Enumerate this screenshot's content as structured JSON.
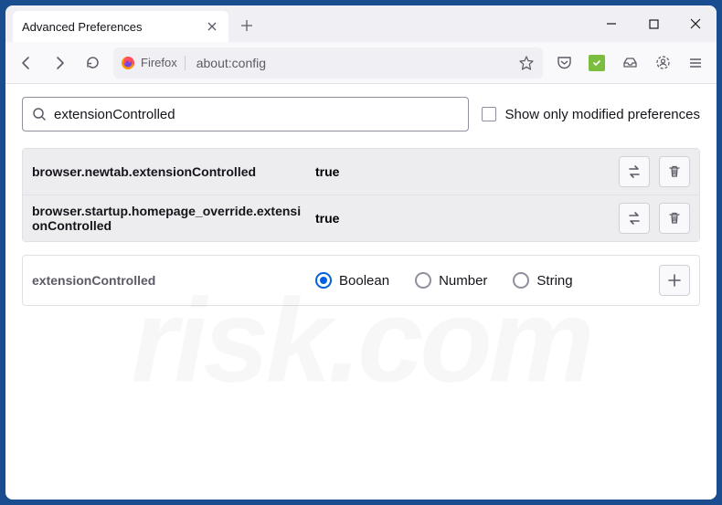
{
  "tab": {
    "title": "Advanced Preferences"
  },
  "urlbar": {
    "identity": "Firefox",
    "url": "about:config"
  },
  "search": {
    "value": "extensionControlled",
    "show_modified_label": "Show only modified preferences"
  },
  "prefs": [
    {
      "name": "browser.newtab.extensionControlled",
      "value": "true"
    },
    {
      "name": "browser.startup.homepage_override.extensionControlled",
      "value": "true"
    }
  ],
  "new_pref": {
    "name": "extensionControlled",
    "types": {
      "boolean": "Boolean",
      "number": "Number",
      "string": "String"
    }
  },
  "watermark": "risk.com"
}
